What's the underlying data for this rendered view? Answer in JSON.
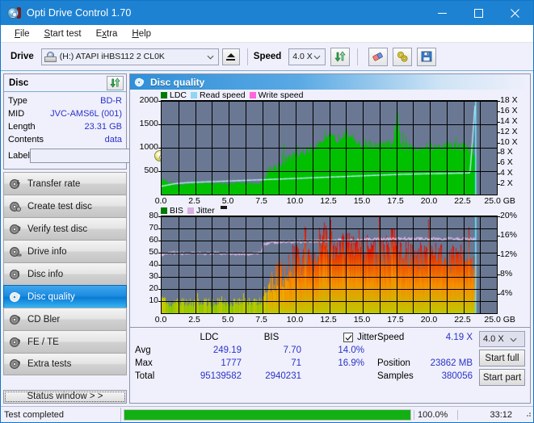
{
  "window": {
    "title": "Opti Drive Control 1.70",
    "icon": "disc-icon",
    "minimize": "minimize-icon",
    "maximize": "maximize-icon",
    "close": "close-icon"
  },
  "menubar": {
    "items": [
      {
        "label": "File",
        "accel": "F"
      },
      {
        "label": "Start test",
        "accel": "S"
      },
      {
        "label": "Extra",
        "accel": "x"
      },
      {
        "label": "Help",
        "accel": "H"
      }
    ]
  },
  "toolbar": {
    "drive_label": "Drive",
    "drive_value": "(H:)  ATAPI iHBS112  2 CL0K",
    "eject_label": "eject-icon",
    "speed_label": "Speed",
    "speed_value": "4.0 X",
    "refresh_icon": "refresh-icon",
    "eraser_icon": "eraser-icon",
    "tools_icon": "tools-icon",
    "save_icon": "save-icon"
  },
  "disc_panel": {
    "title": "Disc",
    "refresh_icon": "refresh-icon",
    "rows": [
      {
        "key": "Type",
        "value": "BD-R"
      },
      {
        "key": "MID",
        "value": "JVC-AMS6L (001)"
      },
      {
        "key": "Length",
        "value": "23.31 GB"
      },
      {
        "key": "Contents",
        "value": "data"
      }
    ],
    "label_key": "Label",
    "label_value": "",
    "label_placeholder": "",
    "label_button_icon": "cd-icon"
  },
  "nav": {
    "items": [
      {
        "label": "Transfer rate",
        "icon": "disc-transfer-icon",
        "active": false
      },
      {
        "label": "Create test disc",
        "icon": "disc-create-icon",
        "active": false
      },
      {
        "label": "Verify test disc",
        "icon": "disc-verify-icon",
        "active": false
      },
      {
        "label": "Drive info",
        "icon": "disc-drive-icon",
        "active": false
      },
      {
        "label": "Disc info",
        "icon": "disc-info-icon",
        "active": false
      },
      {
        "label": "Disc quality",
        "icon": "disc-quality-icon",
        "active": true
      },
      {
        "label": "CD Bler",
        "icon": "disc-bler-icon",
        "active": false
      },
      {
        "label": "FE / TE",
        "icon": "disc-fete-icon",
        "active": false
      },
      {
        "label": "Extra tests",
        "icon": "disc-extra-icon",
        "active": false
      }
    ],
    "status_button": "Status window > >"
  },
  "content": {
    "header_title": "Disc quality",
    "header_icon": "disc-quality-icon"
  },
  "stats": {
    "col_ldc": "LDC",
    "col_bis": "BIS",
    "rows": [
      {
        "label": "Avg",
        "ldc": "249.19",
        "bis": "7.70"
      },
      {
        "label": "Max",
        "ldc": "1777",
        "bis": "71"
      },
      {
        "label": "Total",
        "ldc": "95139582",
        "bis": "2940231"
      }
    ],
    "jitter_label": "Jitter",
    "jitter_checked": true,
    "jitter_avg": "14.0%",
    "jitter_max": "16.9%",
    "speed_label": "Speed",
    "speed_value": "4.19 X",
    "position_label": "Position",
    "position_value": "23862 MB",
    "samples_label": "Samples",
    "samples_value": "380056",
    "speed_select": "4.0 X",
    "start_full": "Start full",
    "start_part": "Start part"
  },
  "statusbar": {
    "text": "Test completed",
    "percent": "100.0%",
    "progress": 100,
    "time": "33:12"
  },
  "colors": {
    "accent": "#1e82d2",
    "link": "#2b32c8",
    "ldc_green": "#00b000",
    "read_speed": "#80d0f0",
    "write_speed": "#ff66dd",
    "jitter": "#d9aee0",
    "progress_green": "#13b013",
    "plot_bg": "#6a7893"
  },
  "chart_data": [
    {
      "type": "area",
      "name": "LDC / Read speed",
      "title": "Disc quality",
      "xlabel": "GB",
      "ylabel": "LDC",
      "y2label": "X",
      "xlim": [
        0,
        25.0
      ],
      "ylim": [
        0,
        2000
      ],
      "y2lim": [
        0,
        18
      ],
      "grid": true,
      "legend_position": "top-left",
      "legend": [
        "LDC",
        "Read speed",
        "Write speed"
      ],
      "xticks": [
        "0.0",
        "2.5",
        "5.0",
        "7.5",
        "10.0",
        "12.5",
        "15.0",
        "17.5",
        "20.0",
        "22.5",
        "25.0 GB"
      ],
      "yticks": [
        "2000",
        "1500",
        "1000",
        "500"
      ],
      "y2ticks": [
        "18 X",
        "16 X",
        "14 X",
        "12 X",
        "10 X",
        "8 X",
        "6 X",
        "4 X",
        "2 X"
      ],
      "series": [
        {
          "name": "LDC",
          "color": "#00b000",
          "x": [
            0.0,
            0.5,
            1.0,
            1.5,
            2.0,
            2.5,
            3.0,
            3.5,
            4.0,
            4.5,
            5.0,
            5.5,
            6.0,
            6.5,
            7.0,
            7.5,
            7.9,
            8.2,
            8.6,
            9.0,
            9.5,
            10.0,
            10.5,
            11.0,
            11.5,
            12.0,
            12.3,
            12.7,
            13.0,
            13.4,
            13.8,
            14.0,
            14.4,
            14.8,
            15.2,
            15.6,
            16.0,
            16.4,
            16.8,
            17.2,
            17.6,
            17.8,
            18.2,
            18.6,
            19.0,
            19.5,
            20.0,
            20.5,
            21.0,
            21.5,
            22.0,
            22.4,
            22.8,
            23.3
          ],
          "values": [
            330,
            250,
            190,
            230,
            240,
            235,
            260,
            250,
            245,
            240,
            230,
            245,
            250,
            235,
            240,
            250,
            520,
            560,
            620,
            700,
            780,
            860,
            900,
            960,
            1040,
            1200,
            1180,
            1240,
            1150,
            1260,
            1430,
            1200,
            1080,
            1050,
            1100,
            1080,
            1020,
            1050,
            1080,
            1000,
            1760,
            1050,
            1020,
            1010,
            1000,
            1020,
            1030,
            1000,
            1020,
            1080,
            1010,
            1040,
            1000,
            900
          ]
        },
        {
          "name": "Read speed",
          "color": "#aee4f8",
          "x": [
            0.0,
            1.0,
            2.0,
            3.0,
            4.0,
            5.0,
            6.0,
            7.0,
            8.0,
            9.0,
            10.0,
            11.0,
            12.0,
            13.0,
            14.0,
            15.0,
            16.0,
            17.0,
            18.0,
            19.0,
            20.0,
            21.0,
            22.0,
            23.0,
            23.4
          ],
          "values": [
            1.6,
            2.1,
            2.3,
            2.4,
            2.5,
            2.6,
            2.7,
            2.8,
            2.9,
            3.0,
            3.1,
            3.2,
            3.3,
            3.4,
            3.5,
            3.6,
            3.7,
            3.8,
            3.9,
            3.95,
            4.0,
            4.05,
            4.1,
            4.15,
            18.0
          ],
          "axis": "right"
        },
        {
          "name": "Write speed",
          "color": "#ff66dd",
          "x": [],
          "values": []
        }
      ]
    },
    {
      "type": "area",
      "name": "BIS / Jitter",
      "xlabel": "GB",
      "ylabel": "BIS",
      "y2label": "%",
      "xlim": [
        0,
        25.0
      ],
      "ylim": [
        0,
        80
      ],
      "y2lim": [
        0,
        20
      ],
      "grid": true,
      "legend_position": "top-left",
      "legend": [
        "BIS",
        "Jitter"
      ],
      "xticks": [
        "0.0",
        "2.5",
        "5.0",
        "7.5",
        "10.0",
        "12.5",
        "15.0",
        "17.5",
        "20.0",
        "22.5",
        "25.0 GB"
      ],
      "yticks": [
        "80",
        "70",
        "60",
        "50",
        "40",
        "30",
        "20",
        "10"
      ],
      "y2ticks": [
        "20%",
        "16%",
        "12%",
        "8%",
        "4%"
      ],
      "series": [
        {
          "name": "BIS",
          "color": "#00b000",
          "x": [
            0.0,
            0.5,
            1.0,
            1.5,
            2.0,
            2.5,
            3.0,
            3.5,
            4.0,
            4.5,
            5.0,
            5.5,
            6.0,
            6.5,
            7.0,
            7.4,
            7.7,
            8.0,
            8.4,
            8.8,
            9.2,
            9.6,
            10.0,
            10.5,
            11.0,
            11.5,
            12.0,
            12.5,
            13.0,
            13.4,
            13.8,
            14.2,
            14.6,
            15.0,
            15.4,
            15.8,
            16.2,
            16.6,
            17.0,
            17.4,
            17.6,
            18.0,
            18.5,
            19.0,
            19.5,
            20.0,
            20.5,
            21.0,
            21.5,
            22.0,
            22.5,
            23.0,
            23.3
          ],
          "values": [
            12,
            9,
            8,
            10,
            9,
            9,
            10,
            9,
            9,
            10,
            9,
            9,
            10,
            9,
            10,
            10,
            17,
            26,
            30,
            32,
            34,
            38,
            45,
            40,
            48,
            46,
            70,
            55,
            58,
            62,
            55,
            52,
            58,
            50,
            54,
            48,
            52,
            50,
            55,
            70,
            48,
            50,
            47,
            48,
            46,
            50,
            45,
            48,
            44,
            46,
            50,
            45,
            36
          ]
        },
        {
          "name": "Jitter",
          "color": "#d9aee0",
          "x": [
            0.0,
            0.5,
            1.0,
            1.5,
            2.0,
            2.5,
            3.0,
            3.5,
            4.0,
            4.5,
            5.0,
            5.5,
            6.0,
            6.5,
            7.0,
            7.4,
            7.6,
            8.0,
            8.5,
            9.0,
            9.5,
            10.0,
            10.5,
            11.0,
            11.5,
            12.0,
            12.5,
            13.0,
            13.5,
            14.0,
            14.5,
            15.0,
            15.5,
            16.0,
            16.5,
            17.0,
            17.5,
            18.0,
            18.5,
            19.0,
            19.5,
            20.0,
            20.5,
            21.0,
            21.5,
            22.0,
            22.5,
            23.0,
            23.3
          ],
          "values": [
            12.0,
            12.3,
            12.5,
            12.3,
            12.4,
            12.3,
            12.4,
            12.3,
            12.4,
            12.3,
            12.4,
            12.3,
            12.3,
            12.2,
            12.3,
            12.4,
            14.3,
            14.5,
            14.6,
            14.7,
            14.7,
            14.8,
            14.8,
            14.9,
            14.9,
            14.9,
            15.0,
            15.0,
            15.1,
            15.1,
            15.1,
            15.2,
            15.2,
            15.3,
            15.3,
            15.3,
            15.3,
            15.4,
            15.3,
            15.4,
            15.4,
            15.3,
            15.4,
            15.3,
            15.4,
            15.3,
            15.4,
            15.3,
            15.4
          ],
          "axis": "right"
        }
      ]
    }
  ]
}
